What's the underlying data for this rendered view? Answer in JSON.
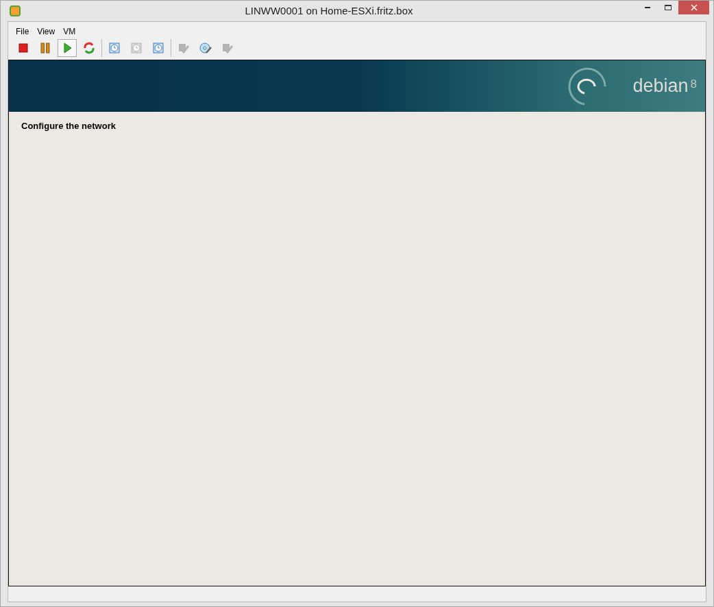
{
  "window": {
    "title": "LINWW0001 on Home-ESXi.fritz.box"
  },
  "menu": [
    {
      "label": "File"
    },
    {
      "label": "View"
    },
    {
      "label": "VM"
    }
  ],
  "toolbar_groups": [
    [
      {
        "kind": "stop",
        "disabled": false,
        "selected": false
      },
      {
        "kind": "pause",
        "disabled": false,
        "selected": false
      },
      {
        "kind": "play",
        "disabled": false,
        "selected": true
      },
      {
        "kind": "reset",
        "disabled": false,
        "selected": false
      }
    ],
    [
      {
        "kind": "snapshot",
        "disabled": false,
        "selected": false
      },
      {
        "kind": "revert",
        "disabled": true,
        "selected": false
      },
      {
        "kind": "manage",
        "disabled": false,
        "selected": false
      }
    ],
    [
      {
        "kind": "floppy",
        "disabled": true,
        "selected": false
      },
      {
        "kind": "cd",
        "disabled": false,
        "selected": false
      },
      {
        "kind": "usb",
        "disabled": true,
        "selected": false
      }
    ]
  ],
  "banner": {
    "brand": "debian",
    "version": "8"
  },
  "installer": {
    "heading": "Configure the network"
  }
}
